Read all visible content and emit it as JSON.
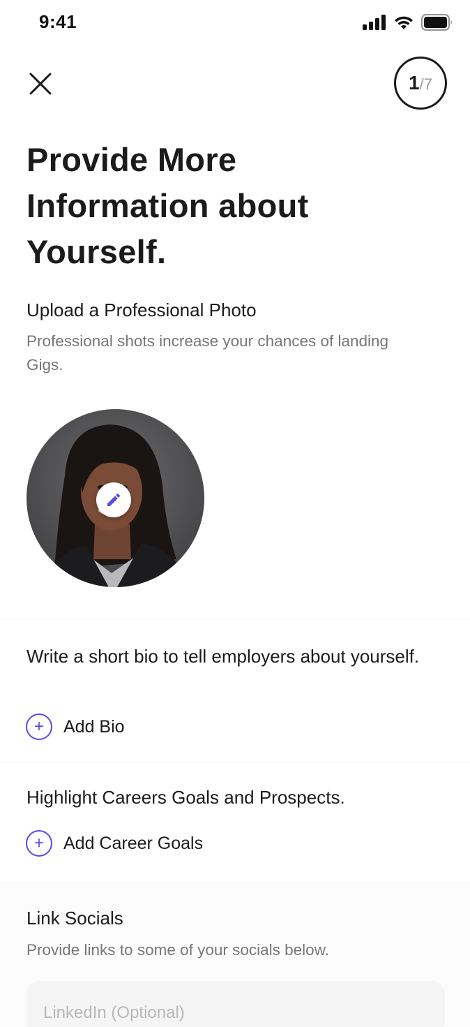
{
  "status_bar": {
    "time": "9:41",
    "icons": [
      "cellular-signal-icon",
      "wifi-icon",
      "battery-icon"
    ]
  },
  "header": {
    "close_icon": "close-icon",
    "step": {
      "current": "1",
      "total": "/7"
    }
  },
  "title": "Provide More Information about Yourself.",
  "photo_section": {
    "heading": "Upload a Professional Photo",
    "description": "Professional shots increase your chances of landing Gigs.",
    "edit_icon": "pencil-icon"
  },
  "bio_section": {
    "heading": "Write a short bio to tell employers about yourself.",
    "add_label": "Add Bio"
  },
  "career_section": {
    "heading": "Highlight Careers Goals and Prospects.",
    "add_label": "Add Career Goals"
  },
  "socials_section": {
    "heading": "Link Socials",
    "description": "Provide links to some of your socials below.",
    "linkedin_placeholder": "LinkedIn (Optional)",
    "linkedin_value": ""
  },
  "colors": {
    "accent": "#5b4ae6",
    "text_primary": "#1b1b1b",
    "text_secondary": "#777777"
  }
}
